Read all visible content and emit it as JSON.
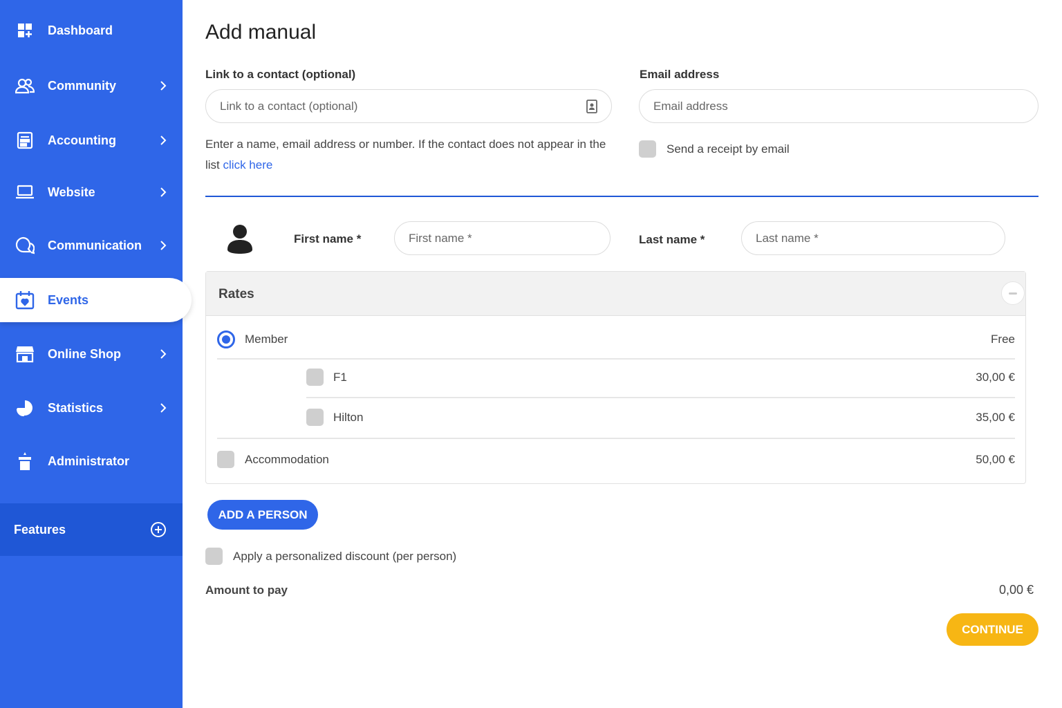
{
  "sidebar": {
    "items": [
      {
        "label": "Dashboard",
        "icon": "dashboard-icon",
        "has_chevron": false
      },
      {
        "label": "Community",
        "icon": "community-icon",
        "has_chevron": true
      },
      {
        "label": "Accounting",
        "icon": "calculator-icon",
        "has_chevron": true
      },
      {
        "label": "Website",
        "icon": "laptop-icon",
        "has_chevron": true
      },
      {
        "label": "Communication",
        "icon": "chat-icon",
        "has_chevron": true
      },
      {
        "label": "Events",
        "icon": "calendar-heart-icon",
        "has_chevron": false,
        "active": true
      },
      {
        "label": "Online Shop",
        "icon": "shop-icon",
        "has_chevron": true
      },
      {
        "label": "Statistics",
        "icon": "pie-chart-icon",
        "has_chevron": true
      },
      {
        "label": "Administrator",
        "icon": "admin-icon",
        "has_chevron": false
      }
    ],
    "features_label": "Features",
    "colors": {
      "background": "#2f66e8",
      "features_background": "#1f57d6"
    }
  },
  "main": {
    "title": "Add manual",
    "contact": {
      "label": "Link to a contact (optional)",
      "placeholder": "Link to a contact (optional)",
      "help_text": "Enter a name, email address or number. If the contact does not appear in the list",
      "help_link": "click here"
    },
    "email": {
      "label": "Email address",
      "placeholder": "Email address",
      "receipt_label": "Send a receipt by email"
    },
    "person": {
      "first_name_label": "First name *",
      "first_name_placeholder": "First name *",
      "last_name_label": "Last name *",
      "last_name_placeholder": "Last name *"
    },
    "rates": {
      "title": "Rates",
      "rows": [
        {
          "name": "Member",
          "price": "Free",
          "control": "radio",
          "selected": true
        },
        {
          "name": "F1",
          "price": "30,00 €",
          "control": "checkbox",
          "checked": false
        },
        {
          "name": "Hilton",
          "price": "35,00 €",
          "control": "checkbox",
          "checked": false
        },
        {
          "name": "Accommodation",
          "price": "50,00 €",
          "control": "checkbox",
          "checked": false
        }
      ]
    },
    "add_person_label": "ADD A PERSON",
    "discount_label": "Apply a personalized discount (per person)",
    "amount_label": "Amount to pay",
    "amount_value": "0,00 €",
    "continue_label": "CONTINUE",
    "colors": {
      "primary": "#2f66e8",
      "continue": "#f7b614"
    }
  }
}
